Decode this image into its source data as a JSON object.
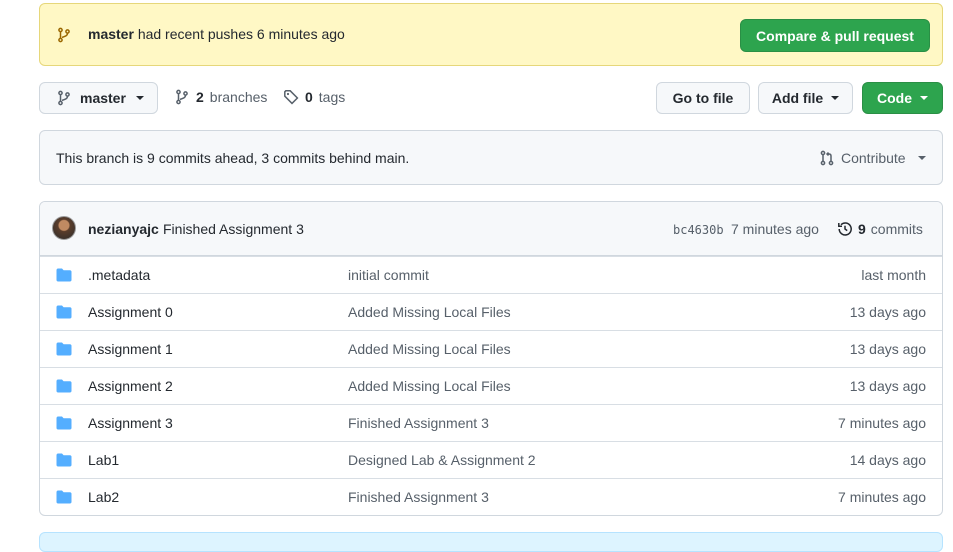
{
  "flash": {
    "branch": "master",
    "message": "had recent pushes 6 minutes ago",
    "compare_button": "Compare & pull request"
  },
  "toolbar": {
    "branch_selector": "master",
    "branches_count": "2",
    "branches_label": "branches",
    "tags_count": "0",
    "tags_label": "tags",
    "go_to_file": "Go to file",
    "add_file": "Add file",
    "code": "Code"
  },
  "ahead_behind": {
    "text": "This branch is 9 commits ahead, 3 commits behind main.",
    "contribute": "Contribute"
  },
  "latest_commit": {
    "author": "nezianyajc",
    "message": "Finished Assignment 3",
    "sha": "bc4630b",
    "time": "7 minutes ago",
    "commits_count": "9",
    "commits_label": "commits"
  },
  "files": [
    {
      "name": ".metadata",
      "message": "initial commit",
      "age": "last month"
    },
    {
      "name": "Assignment 0",
      "message": "Added Missing Local Files",
      "age": "13 days ago"
    },
    {
      "name": "Assignment 1",
      "message": "Added Missing Local Files",
      "age": "13 days ago"
    },
    {
      "name": "Assignment 2",
      "message": "Added Missing Local Files",
      "age": "13 days ago"
    },
    {
      "name": "Assignment 3",
      "message": "Finished Assignment 3",
      "age": "7 minutes ago"
    },
    {
      "name": "Lab1",
      "message": "Designed Lab & Assignment 2",
      "age": "14 days ago"
    },
    {
      "name": "Lab2",
      "message": "Finished Assignment 3",
      "age": "7 minutes ago"
    }
  ],
  "colors": {
    "primary_green": "#2da44e",
    "flash_yellow": "#fff8c5",
    "folder_blue": "#54aeff"
  },
  "icons": {
    "branch": "git-branch-icon",
    "tag": "tag-icon",
    "pull_request": "git-pull-request-icon",
    "history": "history-icon",
    "folder": "folder-icon"
  }
}
